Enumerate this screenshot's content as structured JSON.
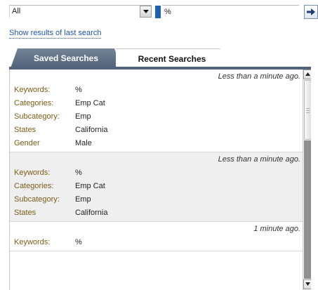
{
  "search": {
    "category_value": "All",
    "keyword_value": "%"
  },
  "last_search_link": "Show results of last search",
  "tabs": [
    {
      "label": "Saved Searches",
      "active": false
    },
    {
      "label": "Recent Searches",
      "active": true
    }
  ],
  "results": [
    {
      "time": "Less than a minute ago.",
      "fields": [
        {
          "label": "Keywords:",
          "value": "%"
        },
        {
          "label": "Categories:",
          "value": "Emp Cat"
        },
        {
          "label": "Subcategory:",
          "value": "Emp"
        },
        {
          "label": "States",
          "value": "California"
        },
        {
          "label": "Gender",
          "value": "Male"
        }
      ]
    },
    {
      "time": "Less than a minute ago.",
      "fields": [
        {
          "label": "Keywords:",
          "value": "%"
        },
        {
          "label": "Categories:",
          "value": "Emp Cat"
        },
        {
          "label": "Subcategory:",
          "value": "Emp"
        },
        {
          "label": "States",
          "value": "California"
        }
      ]
    },
    {
      "time": "1 minute ago.",
      "fields": [
        {
          "label": "Keywords:",
          "value": "%"
        }
      ]
    }
  ],
  "icons": {
    "dropdown": "chevron-down-icon",
    "go": "arrow-right-icon",
    "scroll_up": "scroll-up-icon",
    "scroll_down": "scroll-down-icon"
  },
  "colors": {
    "accent": "#1f62b3",
    "link": "#1f55a8",
    "tab_dark": "#52627a",
    "label": "#7a5c16"
  }
}
